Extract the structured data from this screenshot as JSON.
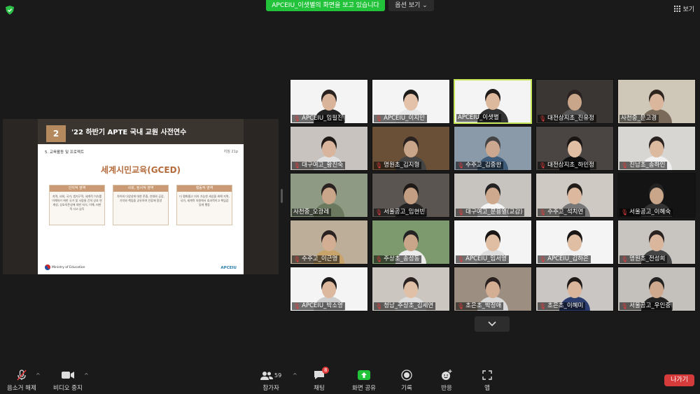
{
  "top": {
    "share_banner": "APCEIU_이샛별의 화면을 보고 있습니다",
    "options": "옵션 보기",
    "view": "보기"
  },
  "slide": {
    "number": "2",
    "title": "'22 하반기 APTE 국내 교원 사전연수",
    "section": "5. 교육활동 및 프로젝트",
    "page": "지침 21p",
    "main_title": "세계시민교육(GCED)",
    "boxes": [
      {
        "head": "인지적 영역",
        "text": "지역, 사회, 국가, 범지구적, 세계적 이슈를 이해하기 위한 국가 및 사람들 간의 상호 연계성, 상호의존성에 대한 지식, 이해, 비판적 사고 습득"
      },
      {
        "head": "사회, 정서적 영역",
        "text": "차이와 다양성에 대한 존중, 연대와 공감, 가치와 책임을 공유하여 인류애 함양"
      },
      {
        "head": "행동적 영역",
        "text": "더 평화롭고 지속 가능한 세상을 위해 지역, 국가, 세계적 차원에서 효과적이고 책임감 있게 행동"
      }
    ],
    "footer_left": "Ministry of Education",
    "footer_right": "APCEIU"
  },
  "participants": [
    {
      "name": "APCEIU_임필진",
      "muted": true,
      "bg": "#f4f4f4",
      "skin": "#d9b49a",
      "hair": "#2a2220",
      "shirt": "#222"
    },
    {
      "name": "APCEIU_이지민",
      "muted": true,
      "bg": "#f4f4f4",
      "skin": "#e3c2a9",
      "hair": "#1d1a1a",
      "shirt": "#e8e8e8"
    },
    {
      "name": "APCEIU_이샛별",
      "muted": false,
      "bg": "#f4f4f4",
      "skin": "#dcb89c",
      "hair": "#201a18",
      "shirt": "#333"
    },
    {
      "name": "대전상지초_진유정",
      "muted": true,
      "bg": "#3a3634",
      "skin": "#c9a58a",
      "hair": "#2a2220",
      "shirt": "#555"
    },
    {
      "name": "사천중_문고경",
      "muted": false,
      "bg": "#cfc7b8",
      "skin": "#dab79c",
      "hair": "#2d241e",
      "shirt": "#7a6a5a"
    },
    {
      "name": "대구여고_황진숙",
      "muted": true,
      "bg": "#c8c3bf",
      "skin": "#d8b59c",
      "hair": "#1f1a18",
      "shirt": "#e0e0e0"
    },
    {
      "name": "명원초_김지형",
      "muted": true,
      "bg": "#6b5038",
      "skin": "#c9a68a",
      "hair": "#2a2220",
      "shirt": "#444"
    },
    {
      "name": "수주고_김중한",
      "muted": true,
      "bg": "#8a9aa8",
      "skin": "#cda890",
      "hair": "#444",
      "shirt": "#3f5d7a"
    },
    {
      "name": "대전상지초_하민정",
      "muted": true,
      "bg": "#4a4542",
      "skin": "#e0bfa5",
      "hair": "#1a1515",
      "shirt": "#111"
    },
    {
      "name": "진남초_송하인",
      "muted": true,
      "bg": "#d8d6d2",
      "skin": "#dcbaa0",
      "hair": "#2a2220",
      "shirt": "#f0f0f0"
    },
    {
      "name": "사천중_오광레",
      "muted": false,
      "bg": "#8e9a83",
      "skin": "#c9a68a",
      "hair": "#2a2220",
      "shirt": "#6b7a5e"
    },
    {
      "name": "서울공고_임현빈",
      "muted": true,
      "bg": "#5a5550",
      "skin": "#c49e82",
      "hair": "#1f1a18",
      "shirt": "#222"
    },
    {
      "name": "대구여고_문용열(교감)",
      "muted": true,
      "bg": "#c7c4bf",
      "skin": "#cfa98e",
      "hair": "#222",
      "shirt": "#f4f4f4"
    },
    {
      "name": "수주고_석치연",
      "muted": true,
      "bg": "#cfc9c4",
      "skin": "#dcb89e",
      "hair": "#221c1a",
      "shirt": "#777"
    },
    {
      "name": "서울공고_이혜숙",
      "muted": true,
      "bg": "#141414",
      "skin": "#c9a68a",
      "hair": "#222",
      "shirt": "#333"
    },
    {
      "name": "수주고_이근영",
      "muted": true,
      "bg": "#bcae98",
      "skin": "#d3ae92",
      "hair": "#2a2220",
      "shirt": "#c9a46a"
    },
    {
      "name": "주상초_송성동",
      "muted": true,
      "bg": "#7c9a6e",
      "skin": "#c9a68a",
      "hair": "#222",
      "shirt": "#ececec"
    },
    {
      "name": "APCEIU_임서영",
      "muted": true,
      "bg": "#f4f4f4",
      "skin": "#e0bea4",
      "hair": "#1a1515",
      "shirt": "#ddd"
    },
    {
      "name": "APCEIU_김하은",
      "muted": true,
      "bg": "#f4f4f4",
      "skin": "#e0bea4",
      "hair": "#1a1515",
      "shirt": "#f0f0f0"
    },
    {
      "name": "명원초_전성희",
      "muted": true,
      "bg": "#c8c4c0",
      "skin": "#dab79c",
      "hair": "#2a2220",
      "shirt": "#444"
    },
    {
      "name": "APCEIU_박소영",
      "muted": true,
      "bg": "#f4f4f4",
      "skin": "#dcb89e",
      "hair": "#1d1a1a",
      "shirt": "#ccc"
    },
    {
      "name": "청남_주상초_김세연",
      "muted": true,
      "bg": "#cbc6c0",
      "skin": "#e0c0a6",
      "hair": "#2a2220",
      "shirt": "#ddd"
    },
    {
      "name": "초은초_박정애",
      "muted": true,
      "bg": "#9c8e80",
      "skin": "#d3ae92",
      "hair": "#2a2220",
      "shirt": "#d8d8d8"
    },
    {
      "name": "초은초_이혜미",
      "muted": true,
      "bg": "#c9c6c4",
      "skin": "#dab79c",
      "hair": "#1f1a18",
      "shirt": "#2c3e70"
    },
    {
      "name": "서울공고_우인중",
      "muted": true,
      "bg": "#c4c0bc",
      "skin": "#cfa98e",
      "hair": "#222",
      "shirt": "#222"
    }
  ],
  "toolbar": {
    "mute": "음소거 해제",
    "video": "비디오 중지",
    "participants": "참가자",
    "participants_count": "59",
    "chat": "채팅",
    "chat_badge": "8",
    "share": "화면 공유",
    "record": "기록",
    "reactions": "반응",
    "apps": "앱",
    "leave": "나가기"
  },
  "colors": {
    "share_green": "#22c33a",
    "leave_red": "#d53b3b",
    "active_speaker": "#c8e65a",
    "slide_accent": "#b56c3d"
  }
}
